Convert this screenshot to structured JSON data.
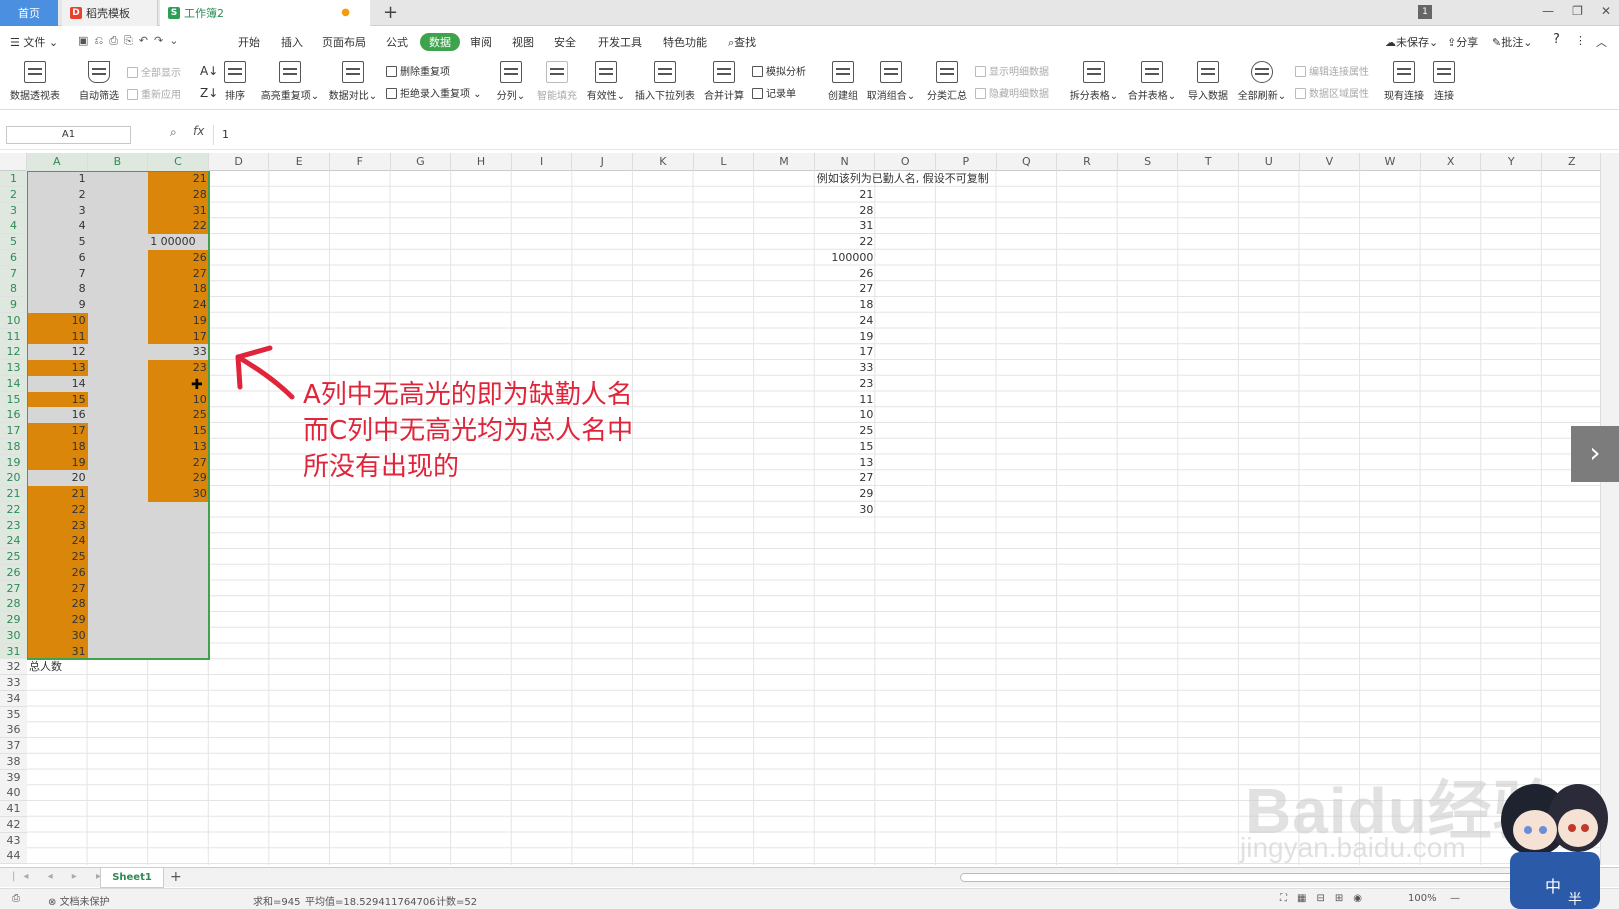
{
  "titlebar": {
    "home": "首页",
    "templates": "稻壳模板",
    "workbook": "工作簿2",
    "badge": "1"
  },
  "menubar": {
    "file": "文件",
    "items": [
      "开始",
      "插入",
      "页面布局",
      "公式",
      "数据",
      "审阅",
      "视图",
      "安全",
      "开发工具",
      "特色功能"
    ],
    "search": "查找",
    "unsaved": "未保存",
    "share": "分享",
    "comment": "批注"
  },
  "ribbon": {
    "pivot": "数据透视表",
    "autofilter": "自动筛选",
    "show_all": "全部显示",
    "reapply": "重新应用",
    "sort": "排序",
    "highlight_dup": "高亮重复项",
    "compare": "数据对比",
    "delete_dup": "删除重复项",
    "reject_dup": "拒绝录入重复项",
    "split": "分列",
    "smart_fill": "智能填充",
    "validity": "有效性",
    "insert_dropdown": "插入下拉列表",
    "consolidate": "合并计算",
    "simulate": "模拟分析",
    "record": "记录单",
    "create_group": "创建组",
    "ungroup": "取消组合",
    "subtotal": "分类汇总",
    "show_detail": "显示明细数据",
    "hide_detail": "隐藏明细数据",
    "split_table": "拆分表格",
    "merge_table": "合并表格",
    "import": "导入数据",
    "refresh_all": "全部刷新",
    "edit_conn": "编辑连接属性",
    "data_area": "数据区域属性",
    "existing_conn": "现有连接",
    "connect": "连接"
  },
  "formula": {
    "namebox": "A1",
    "value": "1"
  },
  "columns": [
    "A",
    "B",
    "C",
    "D",
    "E",
    "F",
    "G",
    "H",
    "I",
    "J",
    "K",
    "L",
    "M",
    "N",
    "O",
    "P",
    "Q",
    "R",
    "S",
    "T",
    "U",
    "V",
    "W",
    "X",
    "Y",
    "Z"
  ],
  "row_count": 44,
  "colA": [
    "1",
    "2",
    "3",
    "4",
    "5",
    "6",
    "7",
    "8",
    "9",
    "10",
    "11",
    "12",
    "13",
    "14",
    "15",
    "16",
    "17",
    "18",
    "19",
    "20",
    "21",
    "22",
    "23",
    "24",
    "25",
    "26",
    "27",
    "28",
    "29",
    "30",
    "31"
  ],
  "colA_highlight": [
    10,
    11,
    13,
    15,
    17,
    18,
    19,
    21,
    22,
    23,
    24,
    25,
    26,
    27,
    28,
    29,
    30,
    31
  ],
  "colC": [
    "21",
    "28",
    "31",
    "22",
    "1  00000",
    "26",
    "27",
    "18",
    "24",
    "19",
    "17",
    "33",
    "23",
    "",
    "10",
    "25",
    "15",
    "13",
    "27",
    "29",
    "30"
  ],
  "colC_highlight": [
    1,
    2,
    3,
    4,
    6,
    7,
    8,
    9,
    10,
    11,
    13,
    14,
    15,
    16,
    17,
    18,
    19,
    20,
    21
  ],
  "a32": "总人数",
  "colO_header": "例如该列为已勤人名, 假设不可复制",
  "colO": [
    "21",
    "28",
    "31",
    "22",
    "100000",
    "26",
    "27",
    "18",
    "24",
    "19",
    "17",
    "33",
    "23",
    "11",
    "10",
    "25",
    "15",
    "13",
    "27",
    "29",
    "30"
  ],
  "annotation": [
    "A列中无高光的即为缺勤人名",
    "而C列中无高光均为总人名中",
    "所没有出现的"
  ],
  "sheet": {
    "tab": "Sheet1"
  },
  "status": {
    "protect": "文档未保护",
    "sum": "求和=945",
    "avg": "平均值=18.529411764706",
    "count": "计数=52",
    "zoom": "100%"
  },
  "watermark": {
    "line1": "Baidu经验",
    "line2": "jingyan.baidu.com"
  },
  "colors": {
    "highlight": "#d9860a",
    "selection": "#3fa34d",
    "annotation": "#e0253b"
  }
}
